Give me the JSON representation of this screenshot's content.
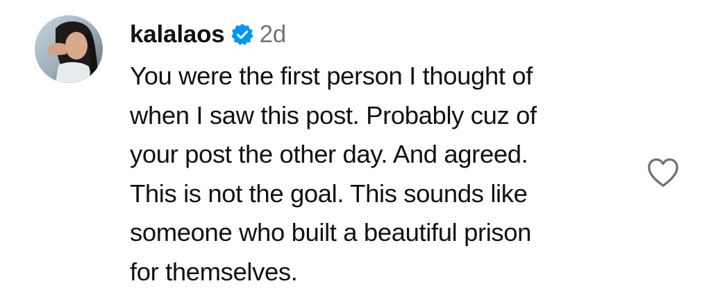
{
  "comment": {
    "username": "kalalaos",
    "verified": true,
    "time": "2d",
    "text": "You were the first person I thought of\nwhen I saw this post. Probably cuz of\nyour post the other day. And agreed.\nThis is not the goal. This sounds like\nsomeone who built a beautiful prison\nfor themselves.",
    "icons": {
      "avatar": "profile-photo",
      "verified": "verified-badge-icon",
      "like": "heart-outline-icon"
    }
  },
  "colors": {
    "text": "#111111",
    "muted": "#737373",
    "verified": "#0095f6",
    "heart": "#737373"
  }
}
